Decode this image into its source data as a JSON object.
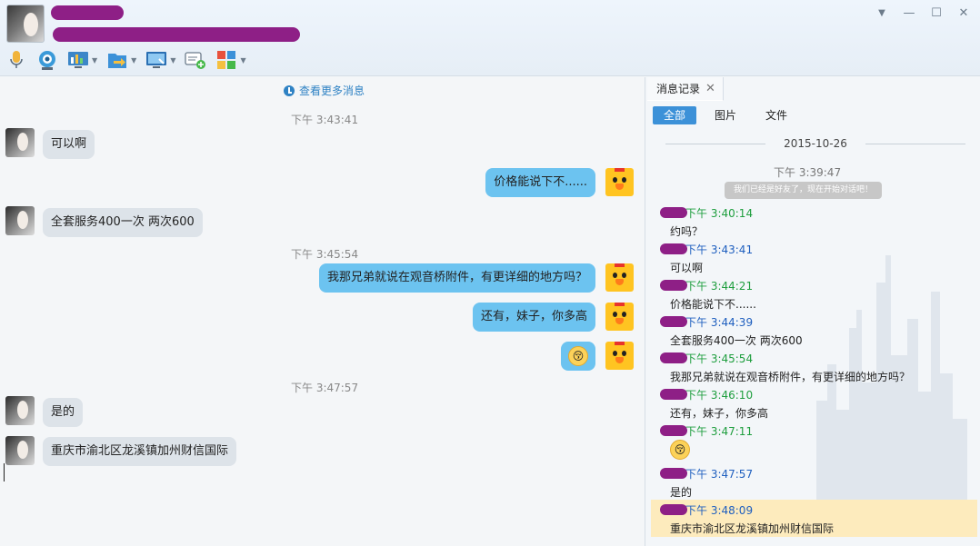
{
  "window": {
    "controls": {
      "dropdown": "▼",
      "minimize": "—",
      "maximize": "☐",
      "close": "✕"
    }
  },
  "toolbar": {
    "items": [
      {
        "icon": "microphone-icon"
      },
      {
        "icon": "video-camera-icon"
      },
      {
        "icon": "screen-share-icon"
      },
      {
        "icon": "file-transfer-icon"
      },
      {
        "icon": "remote-desktop-icon"
      },
      {
        "icon": "create-discussion-icon"
      },
      {
        "icon": "apps-icon"
      }
    ]
  },
  "chat": {
    "view_more": "查看更多消息",
    "timestamps": [
      "下午 3:43:41",
      "下午 3:45:54",
      "下午 3:47:57"
    ],
    "messages": [
      {
        "side": "in",
        "text": "可以啊"
      },
      {
        "side": "out",
        "text": "价格能说下不......"
      },
      {
        "side": "in",
        "text": "全套服务400一次 两次600"
      },
      {
        "side": "out",
        "text": "我那兄弟就说在观音桥附件，有更详细的地方吗？"
      },
      {
        "side": "out",
        "text": "还有，妹子，你多高"
      },
      {
        "side": "out",
        "text": "😚"
      },
      {
        "side": "in",
        "text": "是的"
      },
      {
        "side": "in",
        "text": "重庆市渝北区龙溪镇加州财信国际"
      }
    ]
  },
  "history": {
    "tab_label": "消息记录",
    "tab_close": "✕",
    "filters": [
      "全部",
      "图片",
      "文件"
    ],
    "date": "2015-10-26",
    "system_time": "下午 3:39:47",
    "system_notice": "我们已经是好友了，现在开始对话吧！",
    "entries": [
      {
        "time": "下午 3:40:14",
        "text": "约吗？",
        "color": "#1e9e3e"
      },
      {
        "time": "下午 3:43:41",
        "text": "可以啊",
        "color": "#1f5fbf"
      },
      {
        "time": "下午 3:44:21",
        "text": "价格能说下不......",
        "color": "#1e9e3e"
      },
      {
        "time": "下午 3:44:39",
        "text": "全套服务400一次 两次600",
        "color": "#1f5fbf"
      },
      {
        "time": "下午 3:45:54",
        "text": "我那兄弟就说在观音桥附件，有更详细的地方吗？",
        "color": "#1e9e3e"
      },
      {
        "time": "下午 3:46:10",
        "text": "还有，妹子，你多高",
        "color": "#1e9e3e"
      },
      {
        "time": "下午 3:47:11",
        "text": "😚",
        "color": "#1e9e3e"
      },
      {
        "time": "下午 3:47:57",
        "text": "是的",
        "color": "#1f5fbf"
      },
      {
        "time": "下午 3:48:09",
        "text": "重庆市渝北区龙溪镇加州财信国际",
        "color": "#1f5fbf"
      }
    ]
  }
}
